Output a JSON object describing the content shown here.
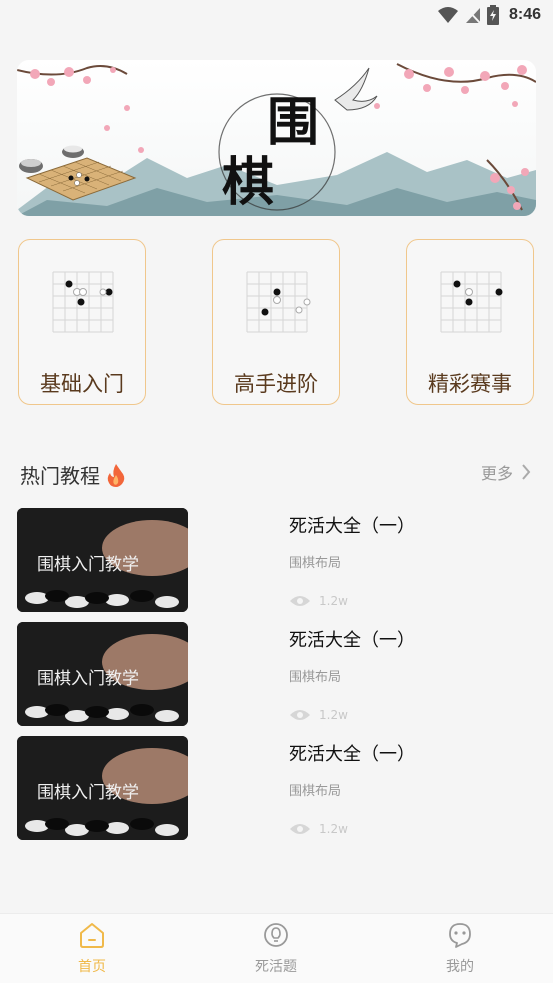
{
  "status_bar": {
    "time": "8:46"
  },
  "banner": {
    "title_chars": [
      "围",
      "棋"
    ],
    "icon": "go-banner-image"
  },
  "categories": [
    {
      "label": "基础入门",
      "icon": "go-board-icon"
    },
    {
      "label": "高手进阶",
      "icon": "go-board-icon"
    },
    {
      "label": "精彩赛事",
      "icon": "go-board-icon"
    }
  ],
  "hot": {
    "title": "热门教程",
    "more": "更多"
  },
  "tutorials": [
    {
      "title": "死活大全（一）",
      "subtitle": "围棋布局",
      "views": "1.2w",
      "thumb_text": "围棋入门教学"
    },
    {
      "title": "死活大全（一）",
      "subtitle": "围棋布局",
      "views": "1.2w",
      "thumb_text": "围棋入门教学"
    },
    {
      "title": "死活大全（一）",
      "subtitle": "围棋布局",
      "views": "1.2w",
      "thumb_text": "围棋入门教学"
    }
  ],
  "tabs": [
    {
      "label": "首页",
      "icon": "home-icon",
      "active": true
    },
    {
      "label": "死活题",
      "icon": "lightbulb-icon",
      "active": false
    },
    {
      "label": "我的",
      "icon": "profile-icon",
      "active": false
    }
  ],
  "colors": {
    "accent": "#f0b94a",
    "card_border": "#f0c78c",
    "inactive": "#999999"
  }
}
